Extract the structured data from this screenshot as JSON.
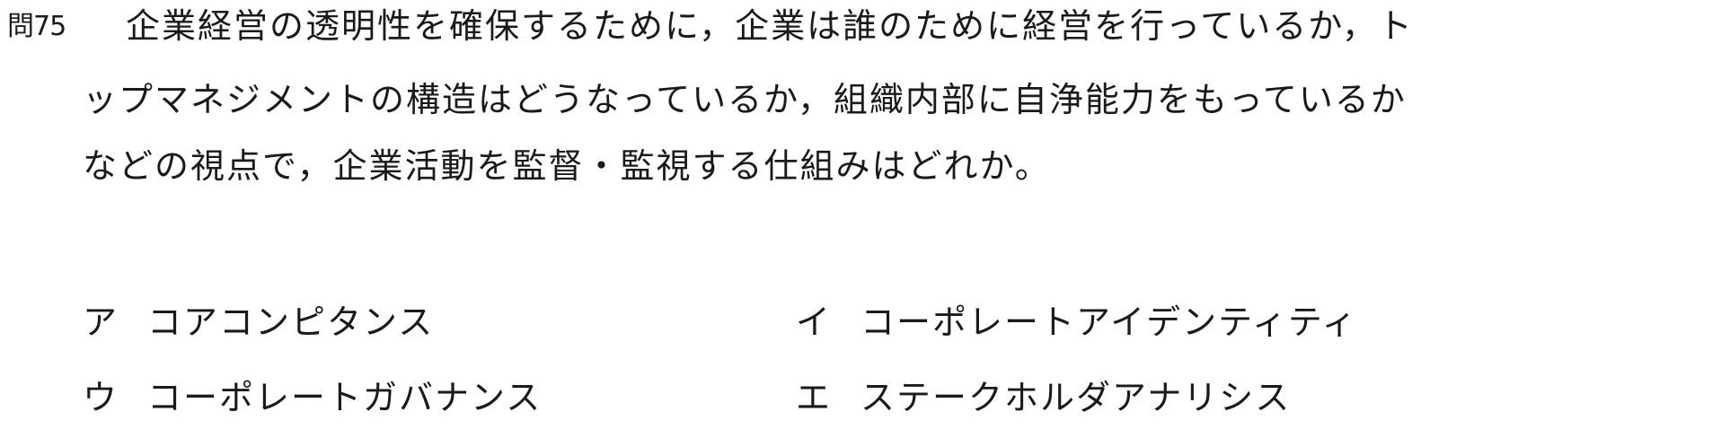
{
  "question": {
    "number": "問75",
    "lines": [
      "企業経営の透明性を確保するために，企業は誰のために経営を行っているか，ト",
      "ップマネジメントの構造はどうなっているか，組織内部に自浄能力をもっているか",
      "などの視点で，企業活動を監督・監視する仕組みはどれか。"
    ]
  },
  "choices": [
    {
      "mark": "ア",
      "text": "コアコンピタンス"
    },
    {
      "mark": "イ",
      "text": "コーポレートアイデンティティ"
    },
    {
      "mark": "ウ",
      "text": "コーポレートガバナンス"
    },
    {
      "mark": "エ",
      "text": "ステークホルダアナリシス"
    }
  ]
}
